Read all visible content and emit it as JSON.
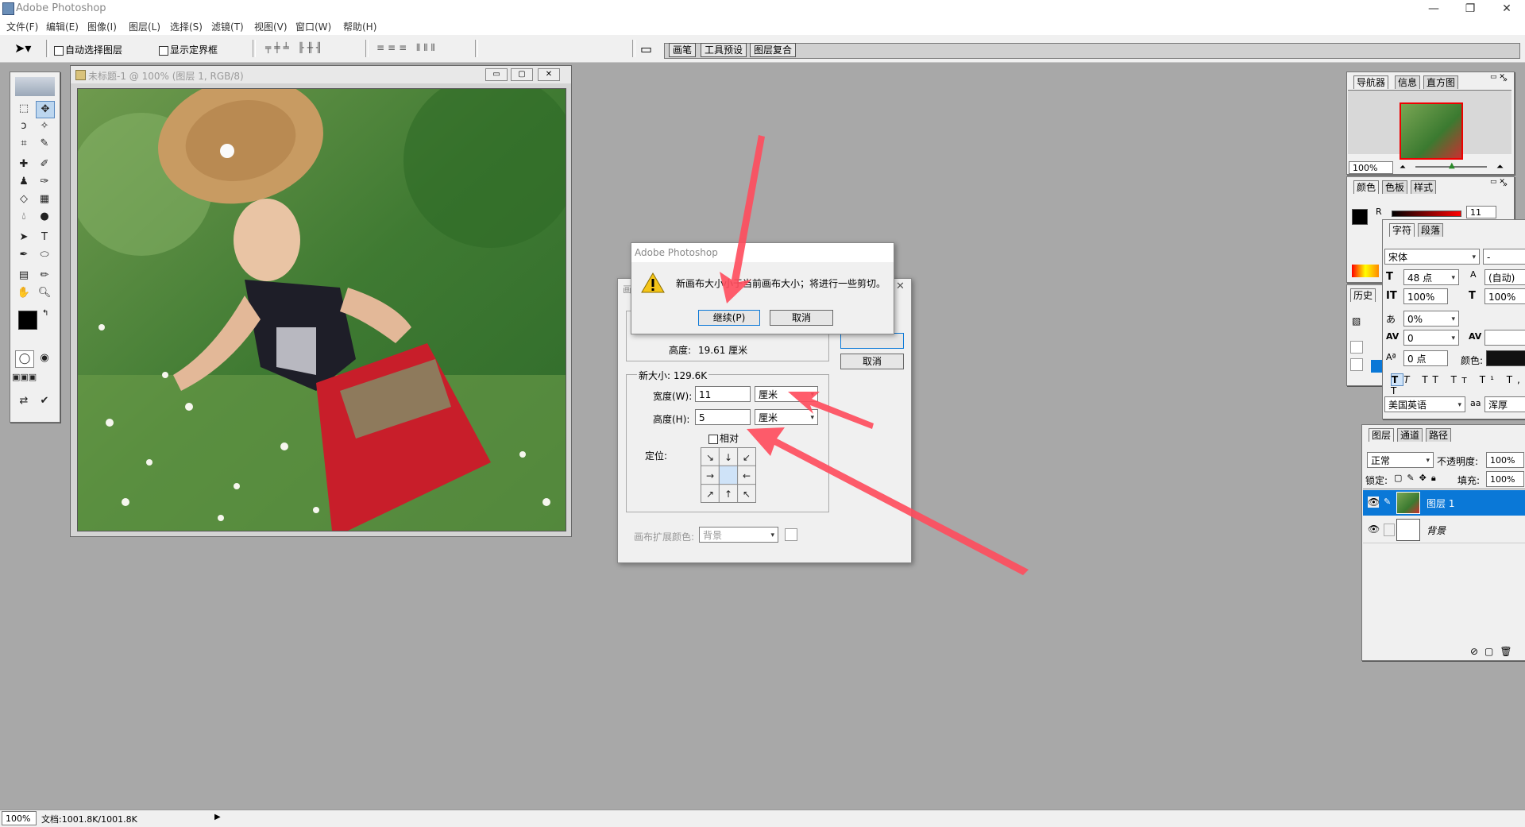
{
  "app": {
    "title": "Adobe Photoshop"
  },
  "menu": [
    "文件(F)",
    "编辑(E)",
    "图像(I)",
    "图层(L)",
    "选择(S)",
    "滤镜(T)",
    "视图(V)",
    "窗口(W)",
    "帮助(H)"
  ],
  "options_bar": {
    "auto_select_label": "自动选择图层",
    "show_bounds_label": "显示定界框",
    "well_tabs": [
      "画笔",
      "工具预设",
      "图层复合"
    ]
  },
  "document": {
    "title": "未标题-1 @ 100% (图层 1, RGB/8)"
  },
  "alert": {
    "title": "Adobe Photoshop",
    "message": "新画布大小小于当前画布大小；将进行一些剪切。",
    "continue_label": "继续(P)",
    "cancel_label": "取消"
  },
  "canvas_dialog": {
    "title_partial": "画",
    "cancel_label": "取消",
    "current_height_label": "高度:",
    "current_height_value": "19.61 厘米",
    "new_size_label": "新大小: 129.6K",
    "width_label": "宽度(W):",
    "width_value": "11",
    "width_unit": "厘米",
    "height_label": "高度(H):",
    "height_value": "5",
    "height_unit": "厘米",
    "relative_label": "相对",
    "anchor_label": "定位:",
    "extension_color_label": "画布扩展颜色:",
    "extension_color_value": "背景"
  },
  "navigator": {
    "tabs": [
      "导航器",
      "信息",
      "直方图"
    ],
    "zoom": "100%"
  },
  "color_palette": {
    "tabs": [
      "颜色",
      "色板",
      "样式"
    ],
    "r_label": "R",
    "r_value": "11"
  },
  "history": {
    "tab": "历史"
  },
  "character": {
    "tabs": [
      "字符",
      "段落"
    ],
    "font": "宋体",
    "font_style": "-",
    "size": "48 点",
    "leading": "(自动)",
    "vscale": "100%",
    "hscale": "100%",
    "tracking_pct": "0%",
    "kerning": "0",
    "baseline": "0 点",
    "color_label": "颜色:",
    "language": "美国英语",
    "antialias": "浑厚"
  },
  "layers": {
    "tabs": [
      "图层",
      "通道",
      "路径"
    ],
    "blend_mode": "正常",
    "opacity_label": "不透明度:",
    "opacity_value": "100%",
    "lock_label": "锁定:",
    "fill_label": "填充:",
    "fill_value": "100%",
    "items": [
      {
        "name": "图层 1",
        "selected": true
      },
      {
        "name": "背景",
        "selected": false
      }
    ]
  },
  "status": {
    "zoom": "100%",
    "doc_info": "文档:1001.8K/1001.8K"
  },
  "colors": {
    "selection_blue": "#0a78d7",
    "annotation_red": "#ff4b5c"
  }
}
